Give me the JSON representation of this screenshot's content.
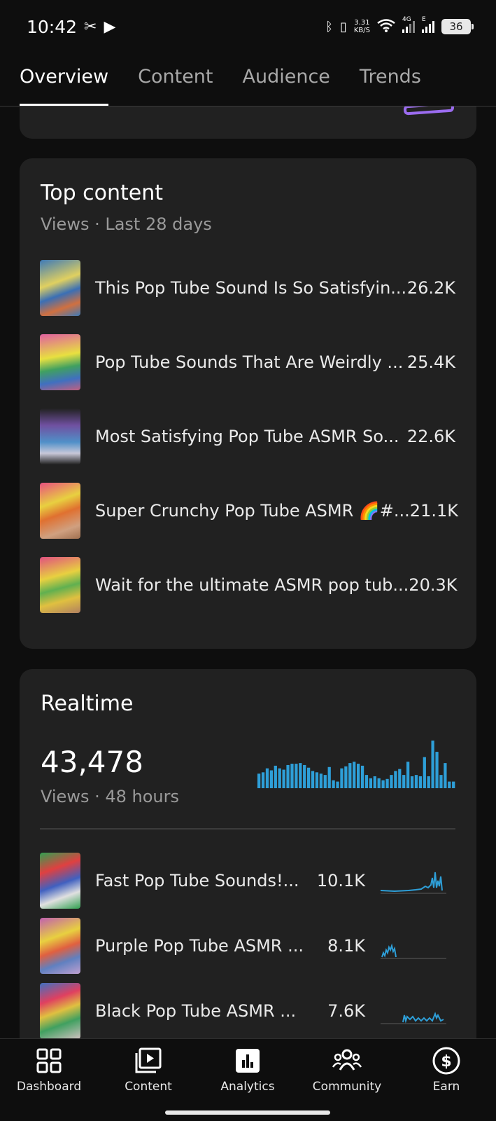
{
  "status_bar": {
    "time": "10:42",
    "net_speed": "3.31",
    "net_unit": "KB/S",
    "sig1_label": "4G",
    "sig2_label": "E",
    "battery": "36"
  },
  "tabs": [
    "Overview",
    "Content",
    "Audience",
    "Trends"
  ],
  "top_content": {
    "title": "Top content",
    "subtitle": "Views · Last 28 days",
    "items": [
      {
        "title": "This Pop Tube Sound Is So Satisfyin...",
        "views": "26.2K"
      },
      {
        "title": "Pop Tube Sounds That Are Weirdly ...",
        "views": "25.4K"
      },
      {
        "title": "Most Satisfying Pop Tube ASMR So...",
        "views": "22.6K"
      },
      {
        "title": "Super Crunchy Pop Tube ASMR 🌈#...",
        "views": "21.1K"
      },
      {
        "title": "Wait for the ultimate ASMR pop tub...",
        "views": "20.3K"
      }
    ]
  },
  "realtime": {
    "title": "Realtime",
    "value": "43,478",
    "subtitle": "Views · 48 hours",
    "bars": [
      22,
      24,
      30,
      27,
      34,
      30,
      28,
      35,
      37,
      37,
      38,
      35,
      31,
      26,
      24,
      22,
      20,
      32,
      12,
      10,
      30,
      33,
      38,
      40,
      37,
      34,
      20,
      15,
      18,
      15,
      12,
      14,
      20,
      26,
      29,
      20,
      40,
      18,
      20,
      18,
      47,
      18,
      72,
      55,
      20,
      38,
      10,
      10
    ],
    "items": [
      {
        "title": "Fast Pop Tube Sounds!...",
        "views": "10.1K"
      },
      {
        "title": "Purple Pop Tube ASMR ...",
        "views": "8.1K"
      },
      {
        "title": "Black Pop Tube ASMR ...",
        "views": "7.6K"
      }
    ]
  },
  "bottom_nav": [
    {
      "label": "Dashboard",
      "icon": "dashboard-icon"
    },
    {
      "label": "Content",
      "icon": "content-icon"
    },
    {
      "label": "Analytics",
      "icon": "analytics-icon"
    },
    {
      "label": "Community",
      "icon": "community-icon"
    },
    {
      "label": "Earn",
      "icon": "earn-icon"
    }
  ],
  "colors": {
    "accent_bar": "#2e9fd8",
    "purple": "#9b6cf0"
  }
}
